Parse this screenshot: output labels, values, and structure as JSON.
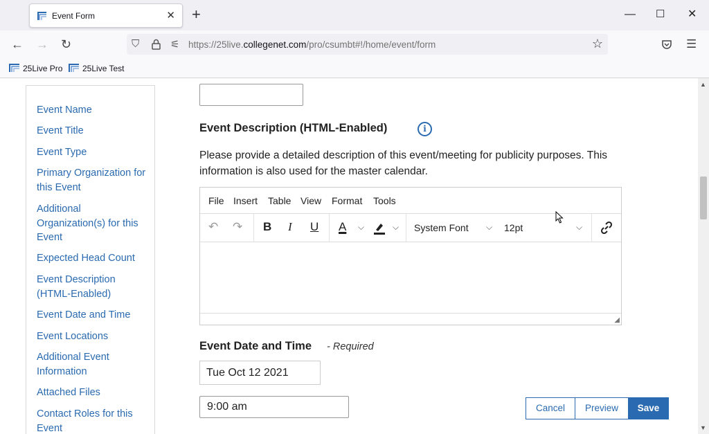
{
  "browser": {
    "tab_title": "Event Form",
    "url_prefix": "https://25live.",
    "url_domain": "collegenet.com",
    "url_path": "/pro/csumbt#!/home/event/form",
    "bookmarks": [
      "25Live Pro",
      "25Live Test"
    ]
  },
  "sidebar": {
    "items": [
      "Event Name",
      "Event Title",
      "Event Type",
      "Primary Organization for this Event",
      "Additional Organization(s) for this Event",
      "Expected Head Count",
      "Event Description (HTML-Enabled)",
      "Event Date and Time",
      "Event Locations",
      "Additional Event Information",
      "Attached Files",
      "Contact Roles for this Event"
    ]
  },
  "description": {
    "title": "Event Description (HTML-Enabled)",
    "help_text": "Please provide a detailed description of this event/meeting for publicity purposes. This information is also used for the master calendar."
  },
  "editor": {
    "menu": [
      "File",
      "Insert",
      "Table",
      "View",
      "Format",
      "Tools"
    ],
    "font": "System Font",
    "size": "12pt"
  },
  "datetime": {
    "title": "Event Date and Time",
    "required": "- Required",
    "date": "Tue Oct 12 2021",
    "time": "9:00 am"
  },
  "actions": {
    "cancel": "Cancel",
    "preview": "Preview",
    "save": "Save"
  },
  "colors": {
    "link": "#2a6ab0",
    "primary_button": "#2a6ab0"
  }
}
